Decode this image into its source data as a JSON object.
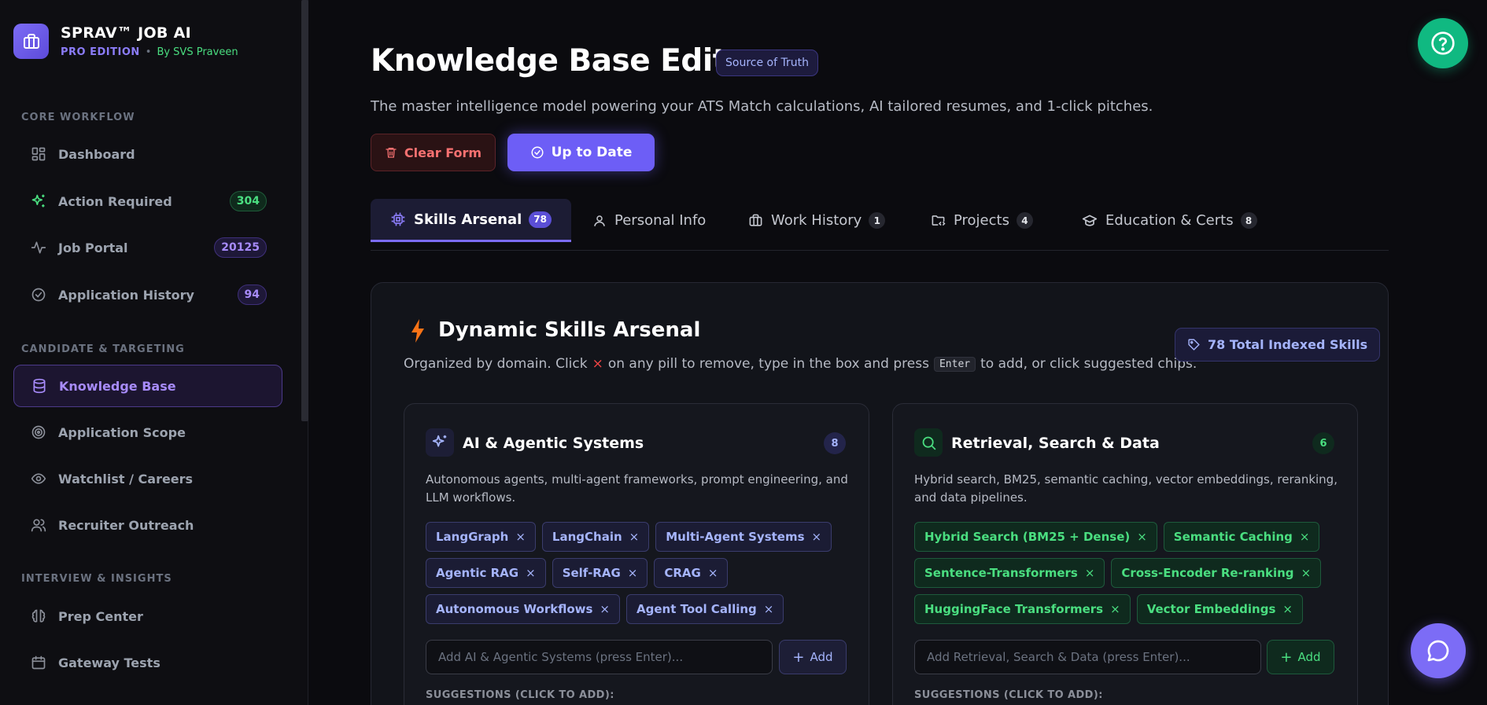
{
  "brand": {
    "title": "SPRAV™ JOB AI",
    "edition": "PRO EDITION",
    "separator": "•",
    "by": "By SVS Praveen",
    "accent": "#7c6cf6"
  },
  "sidebar": {
    "sections": [
      {
        "label": "CORE WORKFLOW"
      },
      {
        "label": "CANDIDATE & TARGETING"
      },
      {
        "label": "INTERVIEW & INSIGHTS"
      }
    ],
    "items": [
      {
        "label": "Dashboard",
        "icon": "dashboard-icon"
      },
      {
        "label": "Action Required",
        "icon": "sparkles-icon",
        "badge": "304"
      },
      {
        "label": "Job Portal",
        "icon": "pulse-icon",
        "badge": "20125"
      },
      {
        "label": "Application History",
        "icon": "check-circle-icon",
        "badge": "94"
      },
      {
        "label": "Knowledge Base",
        "icon": "database-icon",
        "active": true
      },
      {
        "label": "Application Scope",
        "icon": "target-icon"
      },
      {
        "label": "Watchlist / Careers",
        "icon": "eye-icon"
      },
      {
        "label": "Recruiter Outreach",
        "icon": "users-icon"
      },
      {
        "label": "Prep Center",
        "icon": "brain-icon"
      },
      {
        "label": "Gateway Tests",
        "icon": "calendar-icon"
      }
    ]
  },
  "header": {
    "title": "Knowledge Base Editor",
    "badge": "Source of Truth",
    "description": "The master intelligence model powering your ATS Match calculations, AI tailored resumes, and 1-click pitches.",
    "clear_label": "Clear Form",
    "uptodate_label": "Up to Date"
  },
  "tabs": [
    {
      "label": "Skills Arsenal",
      "count": "78",
      "icon": "chip-icon",
      "active": true
    },
    {
      "label": "Personal Info",
      "icon": "user-icon"
    },
    {
      "label": "Work History",
      "count": "1",
      "icon": "briefcase-icon"
    },
    {
      "label": "Projects",
      "count": "4",
      "icon": "folder-code-icon"
    },
    {
      "label": "Education & Certs",
      "count": "8",
      "icon": "graduation-cap-icon"
    }
  ],
  "panel": {
    "title": "Dynamic Skills Arsenal",
    "desc_a": "Organized by domain. Click",
    "desc_x": "×",
    "desc_b": "on any pill to remove, type in the box and press",
    "desc_key": "Enter",
    "desc_c": "to add, or click suggested chips.",
    "total": "78 Total Indexed Skills"
  },
  "cards": [
    {
      "title": "AI & Agentic Systems",
      "count": "8",
      "icon": "sparkles-icon",
      "description": "Autonomous agents, multi-agent frameworks, prompt engineering, and LLM workflows.",
      "skills": [
        "LangGraph",
        "LangChain",
        "Multi-Agent Systems",
        "Agentic RAG",
        "Self-RAG",
        "CRAG",
        "Autonomous Workflows",
        "Agent Tool Calling"
      ],
      "input_placeholder": "Add AI & Agentic Systems (press Enter)...",
      "add_label": "Add",
      "suggestions_label": "SUGGESTIONS (CLICK TO ADD):"
    },
    {
      "title": "Retrieval, Search & Data",
      "count": "6",
      "icon": "search-icon",
      "description": "Hybrid search, BM25, semantic caching, vector embeddings, reranking, and data pipelines.",
      "skills": [
        "Hybrid Search (BM25 + Dense)",
        "Semantic Caching",
        "Sentence-Transformers",
        "Cross-Encoder Re-ranking",
        "HuggingFace Transformers",
        "Vector Embeddings"
      ],
      "input_placeholder": "Add Retrieval, Search & Data (press Enter)...",
      "add_label": "Add",
      "suggestions_label": "SUGGESTIONS (CLICK TO ADD):"
    }
  ],
  "pill_remove_glyph": "×",
  "add_glyph": "+",
  "colors": {
    "ai_pill": "#a5b4fc",
    "retrieval_pill": "#4ade80",
    "help_fab": "#10b981",
    "chat_fab": "#7c6cf6"
  }
}
